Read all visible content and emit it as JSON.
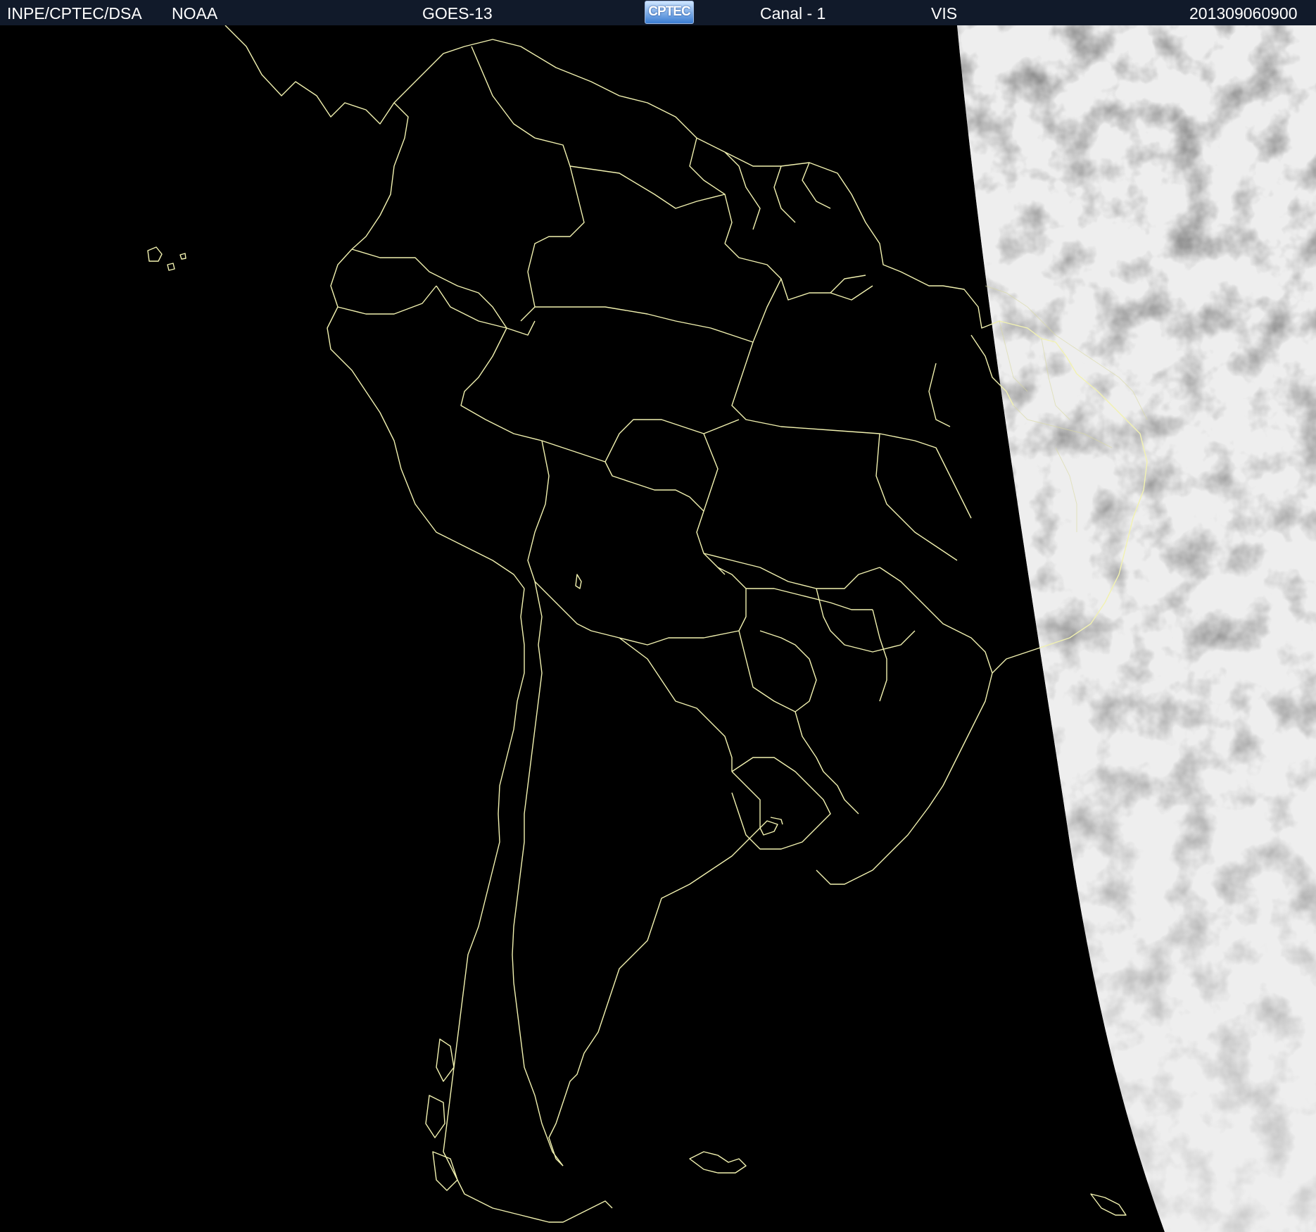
{
  "header": {
    "source": "INPE/CPTEC/DSA",
    "agency": "NOAA",
    "satellite": "GOES-13",
    "logo_text": "CPTEC",
    "channel": "Canal - 1",
    "band": "VIS",
    "timestamp": "201309060900"
  },
  "colors": {
    "header_bg": "#111a2a",
    "border_lines": "#f2f2b0",
    "space": "#000000",
    "clouds": "#d9d9d9"
  },
  "icons": {
    "logo": "cptec-logo"
  }
}
